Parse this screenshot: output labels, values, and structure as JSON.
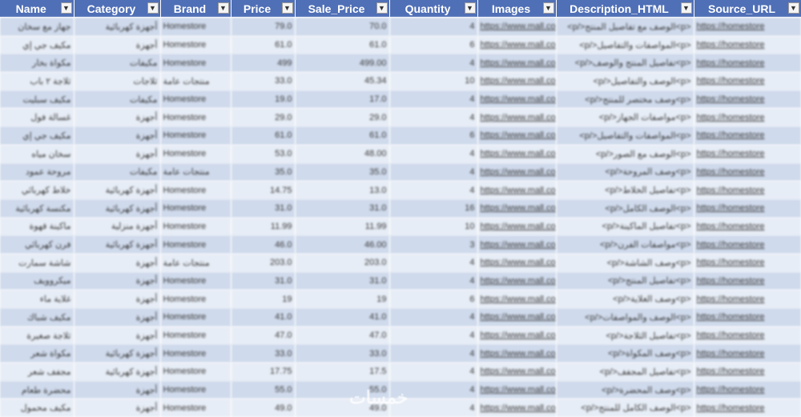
{
  "header": {
    "columns": [
      {
        "label": "Name"
      },
      {
        "label": "Category"
      },
      {
        "label": "Brand"
      },
      {
        "label": "Price"
      },
      {
        "label": "Sale_Price"
      },
      {
        "label": "Quantity"
      },
      {
        "label": "Images"
      },
      {
        "label": "Description_HTML"
      },
      {
        "label": "Source_URL"
      }
    ],
    "filter_icon": "dropdown-arrow-icon"
  },
  "rows": [
    [
      "جهاز مع سخان",
      "أجهزة كهربائية",
      "Homestore",
      "79.0",
      "70.0",
      "4",
      "https://www.mall.com/img/6",
      "<p>الوصف مع تفاصيل المنتج</p>",
      "https://homestore"
    ],
    [
      "مكيف جي إي",
      "أجهزة",
      "Homestore",
      "61.0",
      "61.0",
      "6",
      "https://www.mall.com/img/8",
      "<p>المواصفات والتفاصيل</p>",
      "https://homestore"
    ],
    [
      "مكواة بخار",
      "مكيفات",
      "Homestore",
      "499",
      "499.00",
      "4",
      "https://www.mall.com/img/3",
      "<p>تفاصيل المنتج والوصف</p>",
      "https://homestore"
    ],
    [
      "ثلاجة ٢ باب",
      "ثلاجات",
      "منتجات عامة",
      "33.0",
      "45.34",
      "10",
      "https://www.mall.com/img/5",
      "<p>الوصف والتفاصيل</p>",
      "https://homestore"
    ],
    [
      "مكيف سبليت",
      "مكيفات",
      "Homestore",
      "19.0",
      "17.0",
      "4",
      "https://www.mall.com/img/1",
      "<p>وصف مختصر للمنتج</p>",
      "https://homestore"
    ],
    [
      "غسالة فول",
      "أجهزة",
      "Homestore",
      "29.0",
      "29.0",
      "4",
      "https://www.mall.com/img/2",
      "<p>مواصفات الجهاز</p>",
      "https://homestore"
    ],
    [
      "مكيف جي إي",
      "أجهزة",
      "Homestore",
      "61.0",
      "61.0",
      "6",
      "https://www.mall.com/img/8",
      "<p>المواصفات والتفاصيل</p>",
      "https://homestore"
    ],
    [
      "سخان مياه",
      "أجهزة",
      "Homestore",
      "53.0",
      "48.00",
      "4",
      "https://www.mall.com/img/9",
      "<p>الوصف مع الصور</p>",
      "https://homestore"
    ],
    [
      "مروحة عمود",
      "مكيفات",
      "منتجات عامة",
      "35.0",
      "35.0",
      "4",
      "https://www.mall.com/img/5",
      "<p>وصف المروحة</p>",
      "https://homestore"
    ],
    [
      "خلاط كهربائي",
      "أجهزة كهربائية",
      "Homestore",
      "14.75",
      "13.0",
      "4",
      "https://www.mall.com/img/5",
      "<p>تفاصيل الخلاط</p>",
      "https://homestore"
    ],
    [
      "مكنسة كهربائية",
      "أجهزة كهربائية",
      "Homestore",
      "31.0",
      "31.0",
      "16",
      "https://www.mall.com/img/7",
      "<p>الوصف الكامل</p>",
      "https://homestore"
    ],
    [
      "ماكينة قهوة",
      "أجهزة منزلية",
      "Homestore",
      "11.99",
      "11.99",
      "10",
      "https://www.mall.com/img/4",
      "<p>تفاصيل الماكينة</p>",
      "https://homestore"
    ],
    [
      "فرن كهربائي",
      "أجهزة كهربائية",
      "Homestore",
      "46.0",
      "46.00",
      "3",
      "https://www.mall.com/img/6",
      "<p>مواصفات الفرن</p>",
      "https://homestore"
    ],
    [
      "شاشة سمارت",
      "أجهزة",
      "منتجات عامة",
      "203.0",
      "203.0",
      "4",
      "https://www.mall.com/img/5",
      "<p>وصف الشاشة</p>",
      "https://homestore"
    ],
    [
      "ميكروويف",
      "أجهزة",
      "Homestore",
      "31.0",
      "31.0",
      "4",
      "https://www.mall.com/img/6",
      "<p>تفاصيل المنتج</p>",
      "https://homestore"
    ],
    [
      "غلاية ماء",
      "أجهزة",
      "Homestore",
      "19",
      "19",
      "6",
      "https://www.mall.com/img/2",
      "<p>وصف الغلاية</p>",
      "https://homestore"
    ],
    [
      "مكيف شباك",
      "أجهزة",
      "Homestore",
      "41.0",
      "41.0",
      "4",
      "https://www.mall.com/img/3",
      "<p>الوصف والمواصفات</p>",
      "https://homestore"
    ],
    [
      "ثلاجة صغيرة",
      "أجهزة",
      "Homestore",
      "47.0",
      "47.0",
      "4",
      "https://www.mall.com/img/1",
      "<p>تفاصيل الثلاجة</p>",
      "https://homestore"
    ],
    [
      "مكواة شعر",
      "أجهزة كهربائية",
      "Homestore",
      "33.0",
      "33.0",
      "4",
      "https://www.mall.com/img/5",
      "<p>وصف المكواة</p>",
      "https://homestore"
    ],
    [
      "مجفف شعر",
      "أجهزة كهربائية",
      "Homestore",
      "17.75",
      "17.5",
      "4",
      "https://www.mall.com/img/6",
      "<p>تفاصيل المجفف</p>",
      "https://homestore"
    ],
    [
      "محضرة طعام",
      "أجهزة",
      "Homestore",
      "55.0",
      "55.0",
      "4",
      "https://www.mall.com/img/7",
      "<p>وصف المحضرة</p>",
      "https://homestore"
    ],
    [
      "مكيف محمول",
      "أجهزة",
      "Homestore",
      "49.0",
      "49.0",
      "4",
      "https://www.mall.com/img/8",
      "<p>الوصف الكامل للمنتج</p>",
      "https://homestore"
    ]
  ],
  "watermark": "خمسات"
}
